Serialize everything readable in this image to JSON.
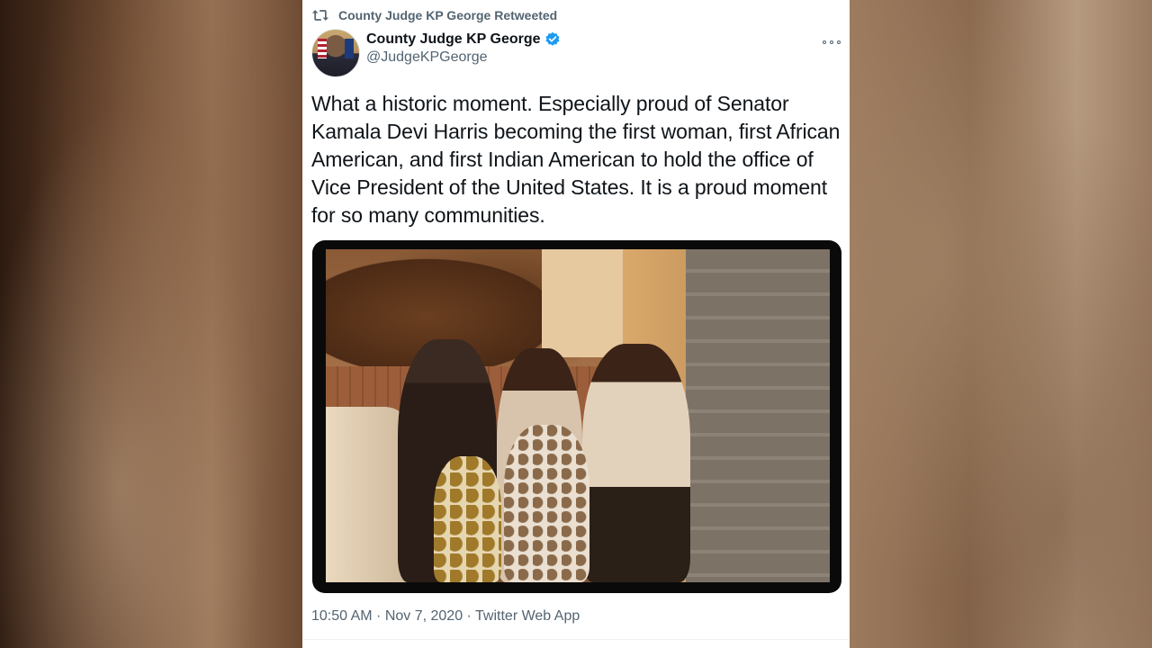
{
  "retweet": {
    "text": "County Judge KP George Retweeted",
    "icon": "retweet-icon"
  },
  "author": {
    "display_name": "County Judge KP George",
    "handle": "@JudgeKPGeorge",
    "verified_icon": "verified-badge-icon",
    "avatar_icon": "profile-avatar"
  },
  "tweet": {
    "text": "What a historic moment. Especially proud of Senator Kamala Devi Harris becoming the first woman, first African American, and first Indian American to hold the office of Vice President of the United States. It is a proud moment for so many communities.",
    "media_icon": "family-photo"
  },
  "meta": {
    "timestamp": "10:50 AM · Nov 7, 2020 · Twitter Web App"
  },
  "colors": {
    "accent": "#1d9bf0",
    "secondary_text": "#536471",
    "primary_text": "#0f1419"
  }
}
